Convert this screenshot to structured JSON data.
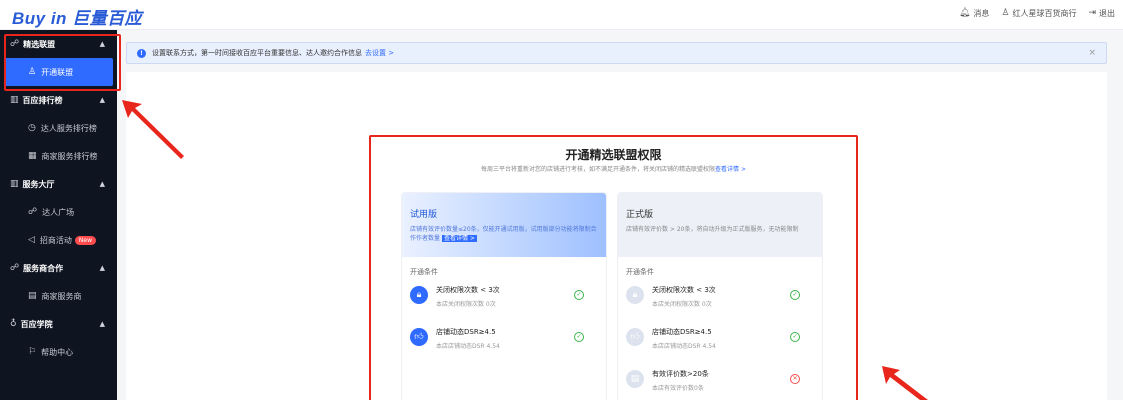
{
  "header": {
    "logo": "Buy in 巨量百应",
    "messages_label": "消息",
    "shop_label": "红人星球百货商行",
    "logout_label": "退出"
  },
  "sidebar": {
    "groups": [
      {
        "label": "精选联盟",
        "items": [
          {
            "label": "开通联盟",
            "active": true
          }
        ]
      },
      {
        "label": "百应排行榜",
        "items": [
          {
            "label": "达人服务排行榜"
          },
          {
            "label": "商家服务排行榜"
          }
        ]
      },
      {
        "label": "服务大厅",
        "items": [
          {
            "label": "达人广场"
          },
          {
            "label": "招商活动",
            "badge": "New"
          }
        ]
      },
      {
        "label": "服务商合作",
        "items": [
          {
            "label": "商家服务商"
          }
        ]
      },
      {
        "label": "百应学院",
        "items": [
          {
            "label": "帮助中心"
          }
        ]
      }
    ]
  },
  "notice": {
    "text": "设置联系方式，第一时间接收百应平台重要信息、达人邀约合作信息",
    "link": "去设置 >"
  },
  "panel": {
    "title": "开通精选联盟权限",
    "subtitle": "每周三平台将重新对您的店铺进行考核，如不满足开通条件，将关闭店铺的精选联盟权限",
    "subtitle_link": "查看详情 >",
    "cards": [
      {
        "title": "试用版",
        "desc": "店铺有效评价数量≤20条，仅能开通试用版，试用版部分功能将限制合作作者数量",
        "desc_link": "查看详情 >",
        "cond_label": "开通条件",
        "conditions": [
          {
            "title": "关闭权限次数 < 3次",
            "sub": "本店关闭权限次数 0次",
            "ok": true
          },
          {
            "title": "店铺动态DSR≥4.5",
            "sub": "本店店铺动态DSR 4.54",
            "ok": true
          }
        ]
      },
      {
        "title": "正式版",
        "desc": "店铺有效评价数 > 20条，将自动升级为正式版服务，无功能限制",
        "cond_label": "开通条件",
        "conditions": [
          {
            "title": "关闭权限次数 < 3次",
            "sub": "本店关闭权限次数 0次",
            "ok": true
          },
          {
            "title": "店铺动态DSR≥4.5",
            "sub": "本店店铺动态DSR 4.54",
            "ok": true
          },
          {
            "title": "有效评价数>20条",
            "sub": "本店有效评价数0条",
            "ok": false
          }
        ]
      }
    ]
  },
  "colors": {
    "accent": "#2f6bff",
    "sidebar_bg": "#0f1421",
    "highlight_red": "#e8261b"
  }
}
